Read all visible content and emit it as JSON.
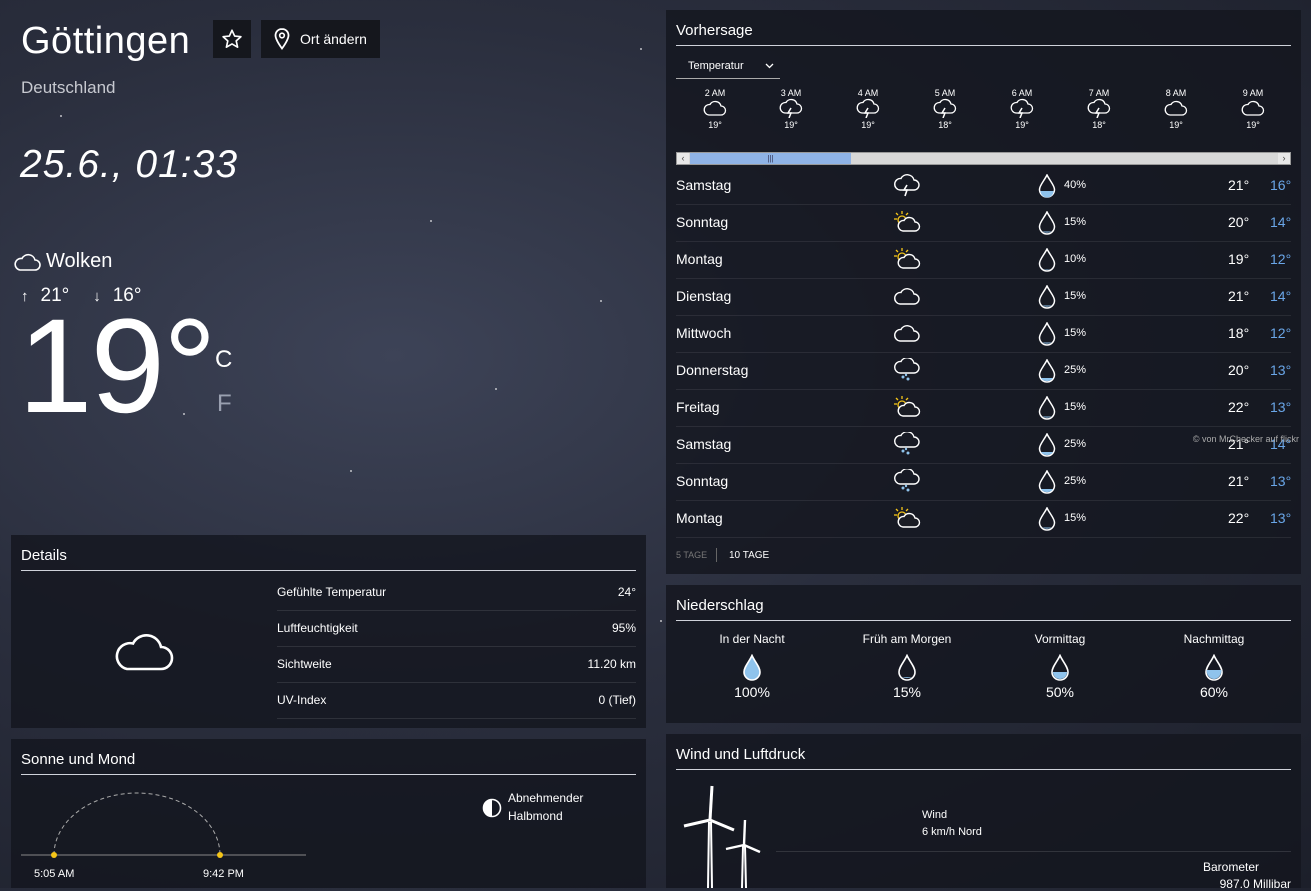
{
  "header": {
    "city": "Göttingen",
    "country": "Deutschland",
    "datetime": "25.6., 01:33",
    "change_location_label": "Ort ändern"
  },
  "current": {
    "condition": "Wolken",
    "high": "21°",
    "low": "16°",
    "temp": "19°",
    "unit_c": "C",
    "unit_f": "F"
  },
  "forecast": {
    "title": "Vorhersage",
    "selector": "Temperatur",
    "hourly": [
      {
        "time": "2 AM",
        "icon": "cloud-icon",
        "temp": "19°"
      },
      {
        "time": "3 AM",
        "icon": "thunderstorm-icon",
        "temp": "19°"
      },
      {
        "time": "4 AM",
        "icon": "thunderstorm-icon",
        "temp": "19°"
      },
      {
        "time": "5 AM",
        "icon": "thunderstorm-icon",
        "temp": "18°"
      },
      {
        "time": "6 AM",
        "icon": "thunderstorm-icon",
        "temp": "19°"
      },
      {
        "time": "7 AM",
        "icon": "thunderstorm-icon",
        "temp": "18°"
      },
      {
        "time": "8 AM",
        "icon": "cloud-icon",
        "temp": "19°"
      },
      {
        "time": "9 AM",
        "icon": "cloud-icon",
        "temp": "19°"
      }
    ],
    "daily": [
      {
        "day": "Samstag",
        "icon": "thunderstorm-icon",
        "rain": "40%",
        "high": "21°",
        "low": "16°"
      },
      {
        "day": "Sonntag",
        "icon": "partly-sunny-icon",
        "rain": "15%",
        "high": "20°",
        "low": "14°"
      },
      {
        "day": "Montag",
        "icon": "partly-sunny-icon",
        "rain": "10%",
        "high": "19°",
        "low": "12°"
      },
      {
        "day": "Dienstag",
        "icon": "cloud-icon",
        "rain": "15%",
        "high": "21°",
        "low": "14°"
      },
      {
        "day": "Mittwoch",
        "icon": "cloud-icon",
        "rain": "15%",
        "high": "18°",
        "low": "12°"
      },
      {
        "day": "Donnerstag",
        "icon": "rain-cloud-icon",
        "rain": "25%",
        "high": "20°",
        "low": "13°"
      },
      {
        "day": "Freitag",
        "icon": "partly-sunny-icon",
        "rain": "15%",
        "high": "22°",
        "low": "13°"
      },
      {
        "day": "Samstag",
        "icon": "rain-cloud-icon",
        "rain": "25%",
        "high": "21°",
        "low": "14°"
      },
      {
        "day": "Sonntag",
        "icon": "rain-cloud-icon",
        "rain": "25%",
        "high": "21°",
        "low": "13°"
      },
      {
        "day": "Montag",
        "icon": "partly-sunny-icon",
        "rain": "15%",
        "high": "22°",
        "low": "13°"
      }
    ],
    "tab_5": "5 TAGE",
    "tab_10": "10 TAGE",
    "credit": "© von MrChecker auf flickr"
  },
  "details": {
    "title": "Details",
    "rows": [
      {
        "label": "Gefühlte Temperatur",
        "value": "24°"
      },
      {
        "label": "Luftfeuchtigkeit",
        "value": "95%"
      },
      {
        "label": "Sichtweite",
        "value": "11.20 km"
      },
      {
        "label": "UV-Index",
        "value": "0 (Tief)"
      }
    ]
  },
  "sun_moon": {
    "title": "Sonne und Mond",
    "sunrise": "5:05 AM",
    "sunset": "9:42 PM",
    "moon_line1": "Abnehmender",
    "moon_line2": "Halbmond"
  },
  "precip": {
    "title": "Niederschlag",
    "items": [
      {
        "label": "In der Nacht",
        "value": "100%",
        "fill": 1.0
      },
      {
        "label": "Früh am Morgen",
        "value": "15%",
        "fill": 0.15
      },
      {
        "label": "Vormittag",
        "value": "50%",
        "fill": 0.5
      },
      {
        "label": "Nachmittag",
        "value": "60%",
        "fill": 0.6
      }
    ]
  },
  "wind": {
    "title": "Wind und Luftdruck",
    "wind_label": "Wind",
    "wind_value": "6 km/h Nord",
    "baro_label": "Barometer",
    "baro_value": "987.0 Millibar"
  },
  "colors": {
    "accent_blue": "#6aa6e8",
    "sun_yellow": "#f5c518",
    "scrollbar_thumb": "#8fb3e6"
  }
}
